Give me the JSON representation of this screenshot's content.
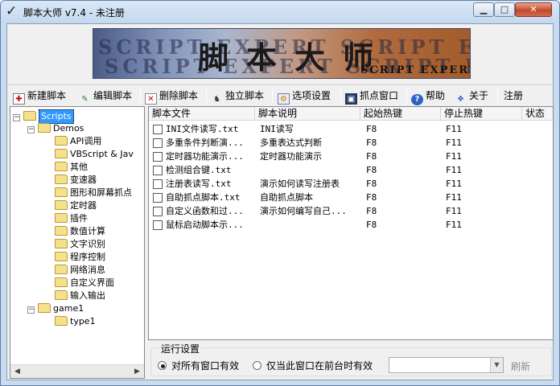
{
  "window": {
    "title": "脚本大师 v7.4 - 未注册"
  },
  "banner": {
    "bg_line1": "SCRIPT EXPERT SCRIPT EXPERT",
    "bg_line2": "SCRIPT EXPERT SCRIPT EXPERT",
    "main": "脚本大师",
    "sub": "SCRIPT EXPERT"
  },
  "toolbar": {
    "new": "新建脚本",
    "edit": "编辑脚本",
    "delete": "删除脚本",
    "standalone": "独立脚本",
    "options": "选项设置",
    "capture": "抓点窗口",
    "help": "帮助",
    "about": "关于",
    "register": "注册"
  },
  "tree": {
    "root": "Scripts",
    "demos": "Demos",
    "demo_children": [
      "API调用",
      "VBScript & Jav",
      "其他",
      "变速器",
      "图形和屏幕抓点",
      "定时器",
      "插件",
      "数值计算",
      "文字识别",
      "程序控制",
      "网络消息",
      "自定义界面",
      "输入输出"
    ],
    "game": "game1",
    "game_children": [
      "type1"
    ]
  },
  "list": {
    "headers": [
      "脚本文件",
      "脚本说明",
      "起始热键",
      "停止热键",
      "状态"
    ],
    "rows": [
      {
        "file": "INI文件读写.txt",
        "desc": "INI读写",
        "start": "F8",
        "stop": "F11",
        "status": ""
      },
      {
        "file": "多重条件判断演...",
        "desc": "多重表达式判断",
        "start": "F8",
        "stop": "F11",
        "status": ""
      },
      {
        "file": "定时器功能演示...",
        "desc": "定时器功能演示",
        "start": "F8",
        "stop": "F11",
        "status": ""
      },
      {
        "file": "检测组合键.txt",
        "desc": "",
        "start": "F8",
        "stop": "F11",
        "status": ""
      },
      {
        "file": "注册表读写.txt",
        "desc": "演示如何读写注册表",
        "start": "F8",
        "stop": "F11",
        "status": ""
      },
      {
        "file": "自助抓点脚本.txt",
        "desc": "自助抓点脚本",
        "start": "F8",
        "stop": "F11",
        "status": ""
      },
      {
        "file": "自定义函数和过...",
        "desc": "演示如何编写自己...",
        "start": "F8",
        "stop": "F11",
        "status": ""
      },
      {
        "file": "鼠标启动脚本示...",
        "desc": "",
        "start": "F8",
        "stop": "F11",
        "status": ""
      }
    ]
  },
  "run_settings": {
    "title": "运行设置",
    "option_all": "对所有窗口有效",
    "option_front": "仅当此窗口在前台时有效",
    "combo_value": "",
    "refresh": "刷新"
  }
}
